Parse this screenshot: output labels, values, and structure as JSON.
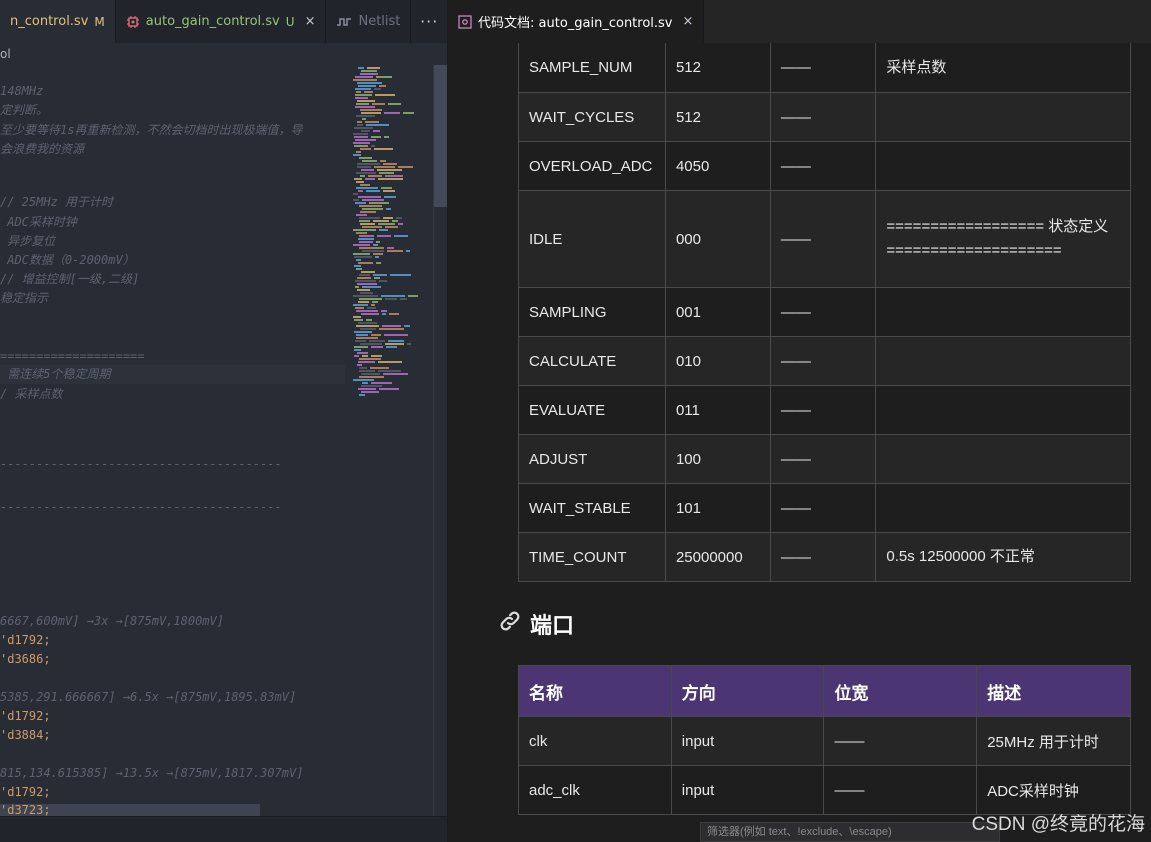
{
  "left_tabs": {
    "tab1": {
      "label": "n_control.sv",
      "badge": "M"
    },
    "tab2": {
      "label": "auto_gain_control.sv",
      "badge": "U",
      "close": "×"
    },
    "tab3": {
      "label": "Netlist"
    },
    "more": "···"
  },
  "breadcrumb": "ol",
  "code_lines": [
    {
      "text": "148MHz",
      "kind": "comment"
    },
    {
      "text": "定判断。",
      "kind": "comment"
    },
    {
      "text": "至少要等待1s再重新检测，不然会切档时出现极端值，导",
      "kind": "comment"
    },
    {
      "text": "会浪费我的资源",
      "kind": "comment"
    },
    {
      "text": "// 25MHz 用于计时",
      "kind": "comment"
    },
    {
      "text": " ADC采样时钟",
      "kind": "comment"
    },
    {
      "text": " 异步复位",
      "kind": "comment"
    },
    {
      "text": " ADC数据（0-2000mV）",
      "kind": "comment"
    },
    {
      "text": "// 增益控制[一级,二级]",
      "kind": "comment"
    },
    {
      "text": "稳定指示",
      "kind": "comment"
    },
    {
      "text": "====================",
      "kind": "comment"
    },
    {
      "text": " 需连续5个稳定周期",
      "kind": "comment"
    },
    {
      "text": "/ 采样点数",
      "kind": "comment"
    },
    {
      "text": "---------------------------------------",
      "kind": "comment"
    },
    {
      "text": "---------------------------------------",
      "kind": "comment"
    },
    {
      "text": "6667,600mV] →3x →[875mV,1800mV]",
      "kind": "comment"
    },
    {
      "text": "'d1792;",
      "kind": "num"
    },
    {
      "text": "'d3686;",
      "kind": "num"
    },
    {
      "text": "5385,291.666667] →6.5x →[875mV,1895.83mV]",
      "kind": "comment"
    },
    {
      "text": "'d1792;",
      "kind": "num"
    },
    {
      "text": "'d3884;",
      "kind": "num"
    },
    {
      "text": "815,134.615385] →13.5x →[875mV,1817.307mV]",
      "kind": "comment"
    },
    {
      "text": "'d1792;",
      "kind": "num"
    },
    {
      "text": "'d3723;",
      "kind": "num"
    }
  ],
  "right_tab": {
    "label": "代码文档: auto_gain_control.sv",
    "close": "×"
  },
  "param_rows": [
    {
      "name": "SAMPLE_NUM",
      "value": "512",
      "dash": "——",
      "desc": "采样点数"
    },
    {
      "name": "WAIT_CYCLES",
      "value": "512",
      "dash": "——",
      "desc": ""
    },
    {
      "name": "OVERLOAD_ADC",
      "value": "4050",
      "dash": "——",
      "desc": ""
    },
    {
      "name": "IDLE",
      "value": "000",
      "dash": "——",
      "desc": "================== 状态定义 ===================="
    },
    {
      "name": "SAMPLING",
      "value": "001",
      "dash": "——",
      "desc": ""
    },
    {
      "name": "CALCULATE",
      "value": "010",
      "dash": "——",
      "desc": ""
    },
    {
      "name": "EVALUATE",
      "value": "011",
      "dash": "——",
      "desc": ""
    },
    {
      "name": "ADJUST",
      "value": "100",
      "dash": "——",
      "desc": ""
    },
    {
      "name": "WAIT_STABLE",
      "value": "101",
      "dash": "——",
      "desc": ""
    },
    {
      "name": "TIME_COUNT",
      "value": "25000000",
      "dash": "——",
      "desc": "0.5s 12500000 不正常"
    }
  ],
  "port_section": {
    "icon": "link-icon",
    "title": "端口",
    "headers": [
      "名称",
      "方向",
      "位宽",
      "描述"
    ],
    "rows": [
      {
        "name": "clk",
        "dir": "input",
        "width": "——",
        "desc": "25MHz 用于计时"
      },
      {
        "name": "adc_clk",
        "dir": "input",
        "width": "——",
        "desc": "ADC采样时钟"
      }
    ]
  },
  "filter_placeholder": "筛选器(例如 text、!exclude、\\escape)",
  "watermark": "CSDN @终竟的花海",
  "colors": {
    "port_header_bg": "#4b3673",
    "comment": "#5c6370",
    "number": "#d19a66",
    "modified_badge": "#e5c07b",
    "untracked_badge": "#98c379"
  }
}
